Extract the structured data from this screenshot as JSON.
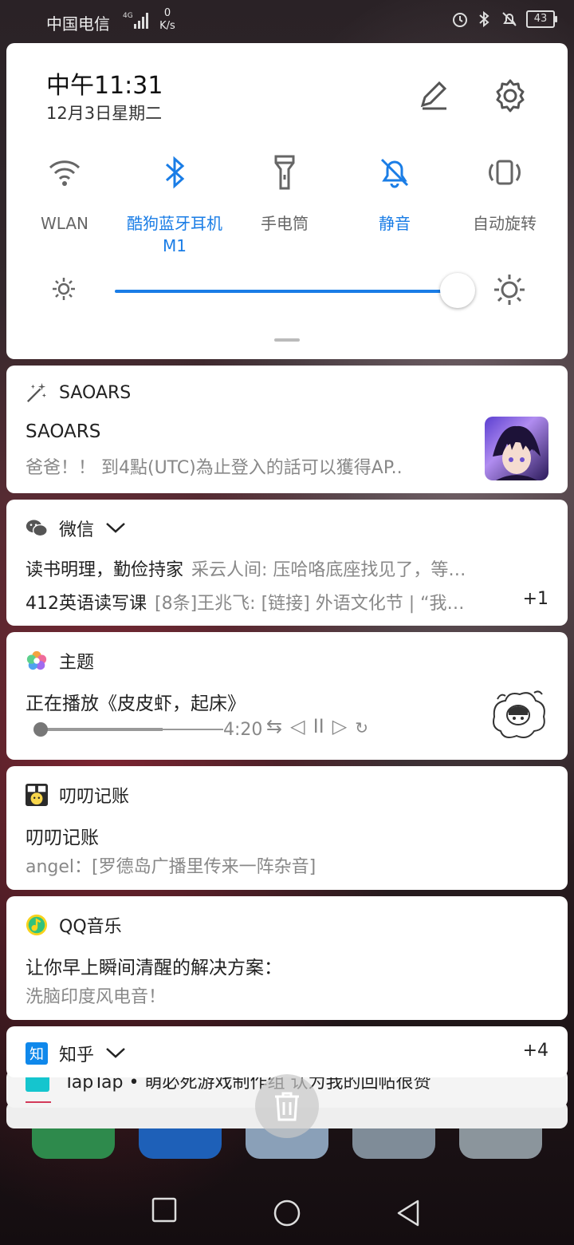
{
  "status_bar": {
    "carrier": "中国电信",
    "net_type": "4G",
    "speed_value": "0",
    "speed_unit": "K/s",
    "battery": "43"
  },
  "quick_settings": {
    "time": "中午11:31",
    "date": "12月3日星期二",
    "tiles": [
      {
        "label": "WLAN",
        "icon": "wifi-icon",
        "active": false
      },
      {
        "label": "酷狗蓝牙耳机 M1",
        "icon": "bluetooth-icon",
        "active": true
      },
      {
        "label": "手电筒",
        "icon": "flashlight-icon",
        "active": false
      },
      {
        "label": "静音",
        "icon": "mute-bell-icon",
        "active": true
      },
      {
        "label": "自动旋转",
        "icon": "auto-rotate-icon",
        "active": false
      }
    ],
    "brightness_fraction": 0.97,
    "accent": "#1a7de6"
  },
  "notifications": {
    "saoars": {
      "app": "SAOARS",
      "title": "SAOARS",
      "text": "爸爸！！ 到4點(UTC)為止登入的話可以獲得AP.."
    },
    "wechat": {
      "app": "微信",
      "row1_title": "读书明理，勤俭持家",
      "row1_text": "采云人间: 压哈咯底座找见了，等…",
      "row2_title": "412英语读写课",
      "row2_text": "[8条]王兆飞: [链接] 外语文化节 | “我…",
      "more": "+1"
    },
    "theme": {
      "app": "主题",
      "title": "正在播放《皮皮虾，起床》",
      "time": "4:20",
      "progress_fraction": 0.67
    },
    "diandian": {
      "app": "叨叨记账",
      "title": "叨叨记账",
      "text": "angel：[罗德岛广播里传来一阵杂音]"
    },
    "qqmusic": {
      "app": "QQ音乐",
      "title": "让你早上瞬间清醒的解决方案：",
      "text": "洗脑印度风电音！"
    },
    "zhihu": {
      "app": "知乎",
      "badge": "知",
      "more": "+4"
    },
    "taptap": {
      "text": "TapTap • 萌必死游戏制作组 认为我的回帖很赞"
    }
  }
}
